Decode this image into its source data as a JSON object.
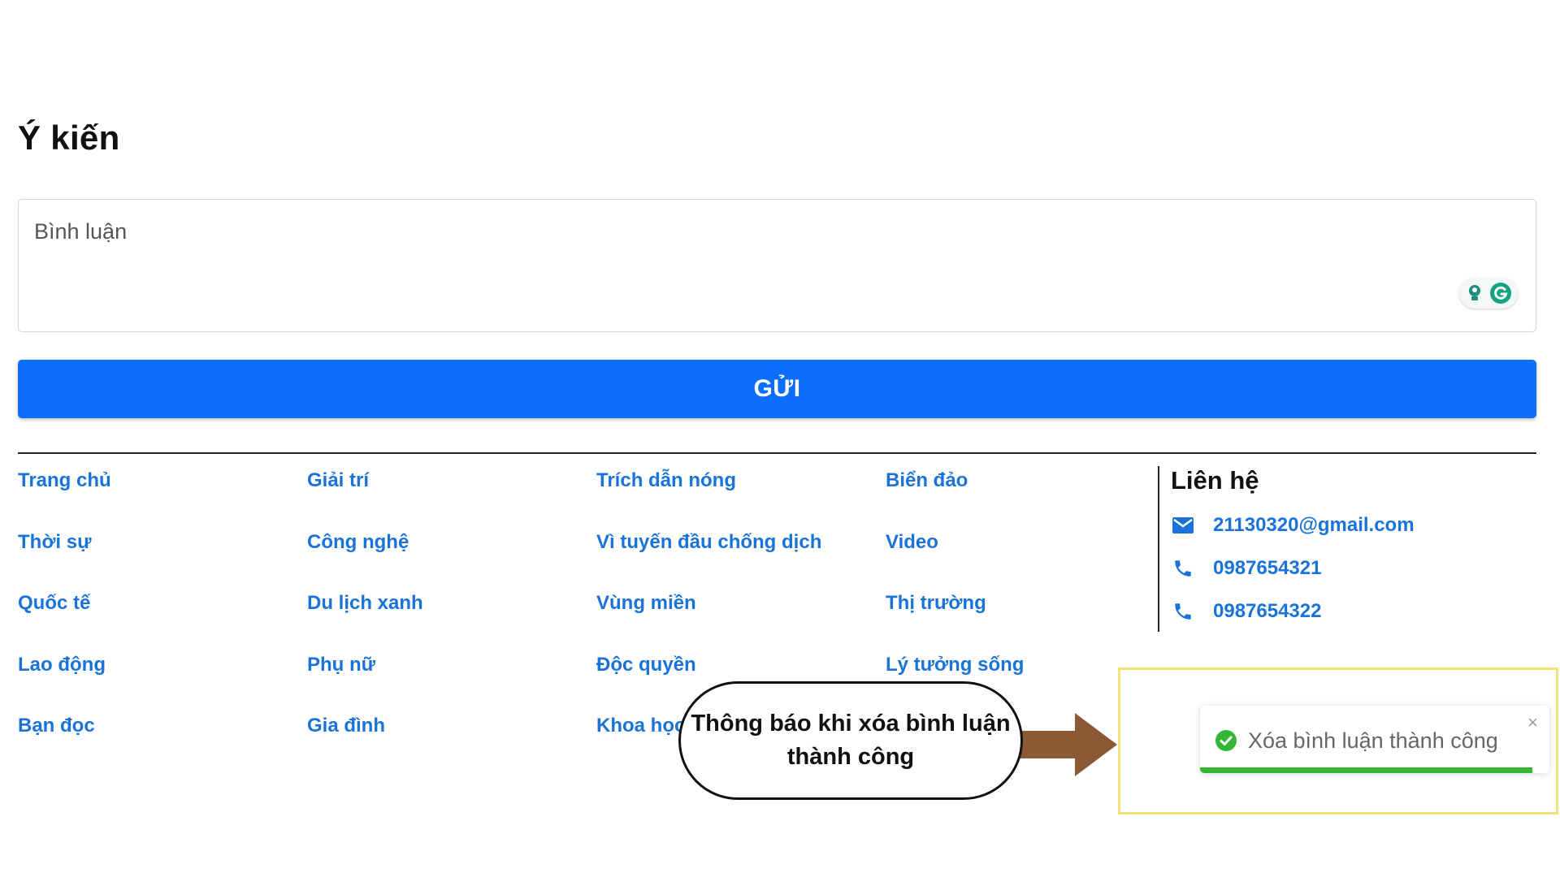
{
  "section": {
    "title": "Ý kiến"
  },
  "comment": {
    "placeholder": "Bình luận",
    "value": "",
    "extension_icons": [
      "lightbulb-icon",
      "grammarly-icon"
    ]
  },
  "submit": {
    "label": "GỬI",
    "color": "#0d6efd"
  },
  "footer": {
    "columns": [
      [
        "Trang chủ",
        "Thời sự",
        "Quốc tế",
        "Lao động",
        "Bạn đọc"
      ],
      [
        "Giải trí",
        "Công nghệ",
        "Du lịch xanh",
        "Phụ nữ",
        "Gia đình"
      ],
      [
        "Trích dẫn nóng",
        "Vì tuyến đầu chống dịch",
        "Vùng miền",
        "Độc quyền",
        "Khoa học"
      ],
      [
        "Biển đảo",
        "Video",
        "Thị trường",
        "Lý tưởng sống",
        ""
      ]
    ],
    "link_color": "#1a73d8"
  },
  "contact": {
    "title": "Liên hệ",
    "email": "21130320@gmail.com",
    "phones": [
      "0987654321",
      "0987654322"
    ]
  },
  "annotation": {
    "callout_text": "Thông báo khi xóa bình luận thành công",
    "arrow_color": "#8b5a34",
    "frame_color": "#f2e27a"
  },
  "toast": {
    "message": "Xóa bình luận thành công",
    "close_label": "×",
    "status": "success",
    "accent": "#35b736",
    "progress": 0.95
  }
}
